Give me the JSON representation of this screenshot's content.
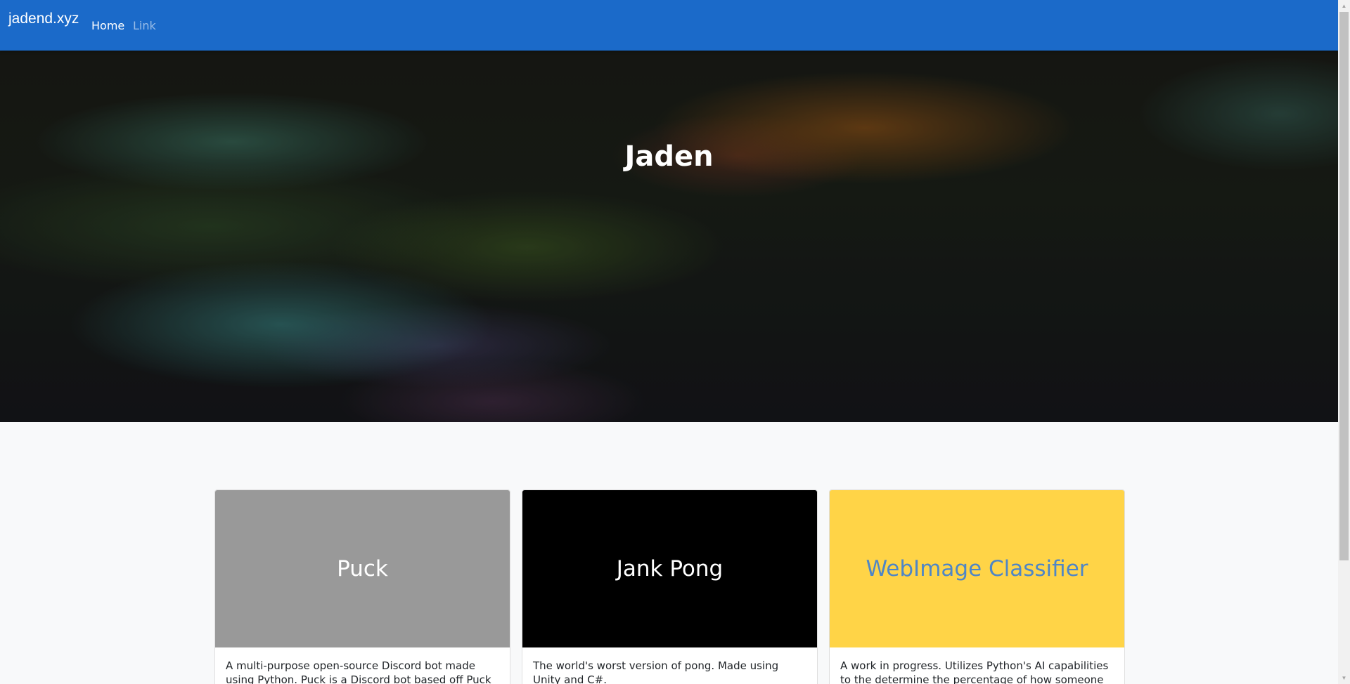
{
  "navbar": {
    "brand": "jadend.xyz",
    "links": [
      {
        "label": "Home"
      },
      {
        "label": "Link"
      }
    ],
    "color": "#1b6ac9"
  },
  "hero": {
    "title": "Jaden"
  },
  "cards": [
    {
      "title": "Puck",
      "cover_color": "#999999",
      "title_color": "#ffffff",
      "text": "A multi-purpose open-source Discord bot made using Python. Puck is a Discord bot based off Puck from Bo"
    },
    {
      "title": "Jank Pong",
      "cover_color": "#000000",
      "title_color": "#ffffff",
      "text": "The world's worst version of pong. Made using Unity and C#."
    },
    {
      "title": "WebImage Classifier",
      "cover_color": "#ffd447",
      "title_color": "#4f86c6",
      "text": "A work in progress. Utilizes Python's AI capabilities to the determine the percentage of how someone looks"
    }
  ],
  "scrollbar": {
    "up_icon": "scroll-up-arrow-icon",
    "down_icon": "scroll-down-arrow-icon"
  }
}
